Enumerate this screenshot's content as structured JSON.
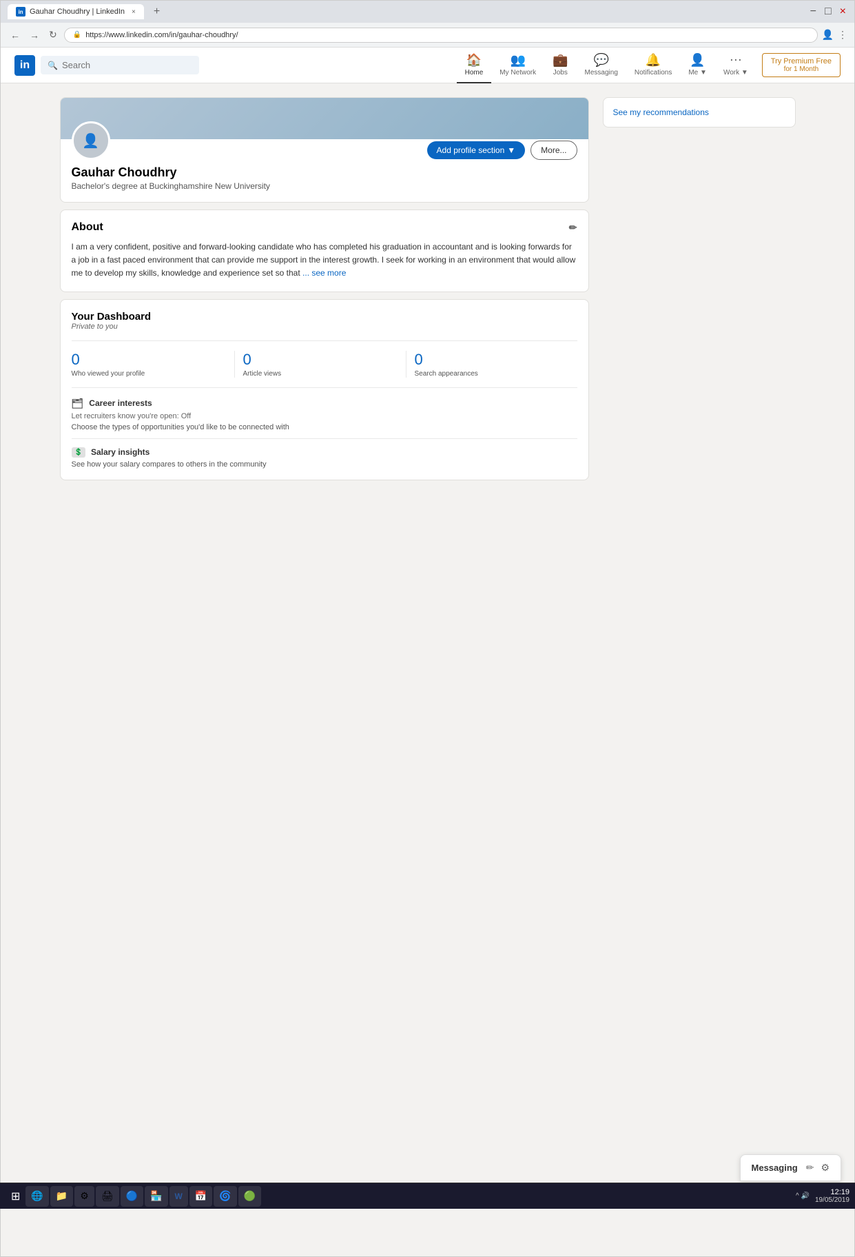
{
  "browser": {
    "tab_favicon": "in",
    "tab_title": "Gauhar Choudhry | LinkedIn",
    "tab_close": "×",
    "tab_new": "+",
    "url": "https://www.linkedin.com/in/gauhar-choudhry/",
    "nav_back": "←",
    "nav_forward": "→",
    "nav_refresh": "↻",
    "window_controls": {
      "minimize": "−",
      "maximize": "□",
      "close": "×"
    }
  },
  "linkedin": {
    "logo": "in",
    "search_placeholder": "Search",
    "nav": {
      "home_label": "Home",
      "home_icon": "🏠",
      "network_label": "My Network",
      "network_icon": "👥",
      "jobs_label": "Jobs",
      "jobs_icon": "💼",
      "messaging_label": "Messaging",
      "messaging_icon": "💬",
      "notifications_label": "Notifications",
      "notifications_icon": "🔔",
      "me_label": "Me",
      "me_icon": "👤",
      "work_label": "Work",
      "work_icon": "⋯",
      "premium_label": "Try Premium Free",
      "premium_sub": "for 1 Month"
    },
    "profile": {
      "name": "Gauhar Choudhry",
      "tagline": "Bachelor's degree at Buckinghamshire New University",
      "add_section_label": "Add profile section",
      "more_label": "More...",
      "dropdown_arrow": "▼"
    },
    "about": {
      "title": "About",
      "edit_icon": "✏",
      "text": "I am a very confident, positive and forward-looking candidate who has completed his graduation in accountant and is looking forwards for a job in a fast paced environment that can provide me support in the interest growth. I seek for working in an environment that would allow me to develop my skills, knowledge and experience set so that",
      "see_more": "... see more"
    },
    "dashboard": {
      "title": "Your Dashboard",
      "subtitle": "Private to you",
      "stats": [
        {
          "number": "0",
          "label": "Who viewed your profile"
        },
        {
          "number": "0",
          "label": "Article views"
        },
        {
          "number": "0",
          "label": "Search appearances"
        }
      ],
      "career_interests": {
        "title": "Career interests",
        "sub": "Let recruiters know you're open: Off",
        "desc": "Choose the types of opportunities you'd like to be connected with",
        "icon": "🗂"
      },
      "salary_insights": {
        "title": "Salary insights",
        "desc": "See how your salary compares to others in the community",
        "icon": "💲"
      }
    },
    "recommendations": {
      "link": "See my recommendations"
    },
    "messaging": {
      "label": "Messaging",
      "edit_icon": "✏",
      "settings_icon": "⚙"
    }
  },
  "taskbar": {
    "start_icon": "⊞",
    "items": [
      {
        "icon": "🌐"
      },
      {
        "icon": "⚙"
      },
      {
        "icon": "🎨"
      },
      {
        "icon": "🔵"
      },
      {
        "icon": "📄"
      },
      {
        "icon": "W"
      },
      {
        "icon": "📅"
      },
      {
        "icon": "🌀"
      },
      {
        "icon": "🟢"
      }
    ],
    "time": "12:19",
    "date": "19/05/2019",
    "tray": "^ ▲ 🔊"
  }
}
